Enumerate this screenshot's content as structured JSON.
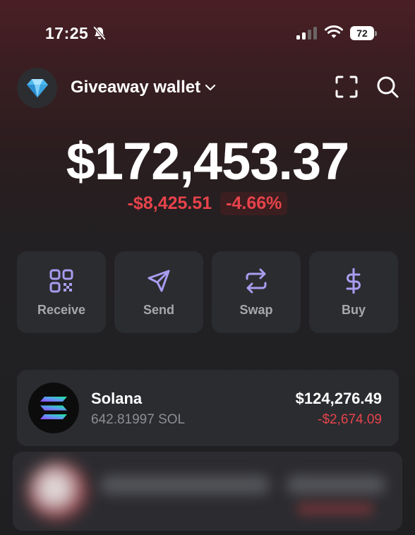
{
  "status_bar": {
    "time": "17:25",
    "battery": "72"
  },
  "header": {
    "wallet_name": "Giveaway wallet",
    "avatar_icon": "diamond-icon",
    "actions": [
      "scan-icon",
      "search-icon"
    ]
  },
  "balance": {
    "total": "$172,453.37",
    "change_amount": "-$8,425.51",
    "change_percent": "-4.66%"
  },
  "actions": [
    {
      "label": "Receive",
      "icon": "qr-code-icon"
    },
    {
      "label": "Send",
      "icon": "send-icon"
    },
    {
      "label": "Swap",
      "icon": "swap-icon"
    },
    {
      "label": "Buy",
      "icon": "dollar-icon"
    }
  ],
  "tokens": [
    {
      "name": "Solana",
      "amount": "642.81997 SOL",
      "value": "$124,276.49",
      "change": "-$2,674.09"
    }
  ],
  "colors": {
    "negative": "#e7434b",
    "accent": "#a99cf0",
    "card": "#2b2c30"
  }
}
